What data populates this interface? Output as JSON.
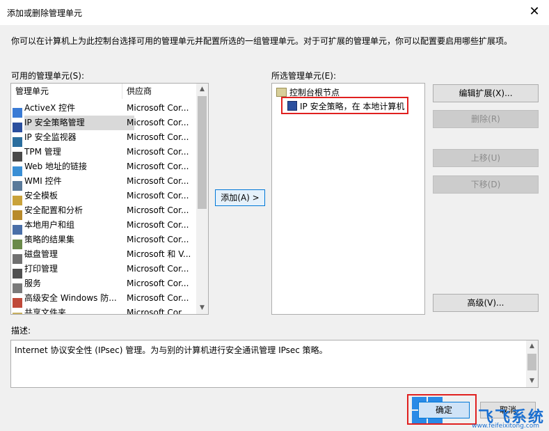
{
  "window": {
    "title": "添加或删除管理单元",
    "close_glyph": "✕"
  },
  "intro": "你可以在计算机上为此控制台选择可用的管理单元并配置所选的一组管理单元。对于可扩展的管理单元，你可以配置要启用哪些扩展项。",
  "available": {
    "label": "可用的管理单元(S):",
    "col_name": "管理单元",
    "col_vendor": "供应商",
    "items": [
      {
        "name": "ActiveX 控件",
        "vendor": "Microsoft Cor...",
        "icon": "activex-icon"
      },
      {
        "name": "IP 安全策略管理",
        "vendor": "Microsoft Cor...",
        "icon": "ip-security-policy-icon"
      },
      {
        "name": "IP 安全监视器",
        "vendor": "Microsoft Cor...",
        "icon": "ip-security-monitor-icon"
      },
      {
        "name": "TPM 管理",
        "vendor": "Microsoft Cor...",
        "icon": "tpm-icon"
      },
      {
        "name": "Web 地址的链接",
        "vendor": "Microsoft Cor...",
        "icon": "web-link-icon"
      },
      {
        "name": "WMI 控件",
        "vendor": "Microsoft Cor...",
        "icon": "wmi-icon"
      },
      {
        "name": "安全模板",
        "vendor": "Microsoft Cor...",
        "icon": "security-template-icon"
      },
      {
        "name": "安全配置和分析",
        "vendor": "Microsoft Cor...",
        "icon": "security-config-icon"
      },
      {
        "name": "本地用户和组",
        "vendor": "Microsoft Cor...",
        "icon": "users-groups-icon"
      },
      {
        "name": "策略的结果集",
        "vendor": "Microsoft Cor...",
        "icon": "rsop-icon"
      },
      {
        "name": "磁盘管理",
        "vendor": "Microsoft 和 V...",
        "icon": "disk-management-icon"
      },
      {
        "name": "打印管理",
        "vendor": "Microsoft Cor...",
        "icon": "print-management-icon"
      },
      {
        "name": "服务",
        "vendor": "Microsoft Cor...",
        "icon": "services-icon"
      },
      {
        "name": "高级安全 Windows 防...",
        "vendor": "Microsoft Cor...",
        "icon": "firewall-icon"
      },
      {
        "name": "共享文件夹",
        "vendor": "Microsoft Cor...",
        "icon": "shared-folder-icon"
      }
    ]
  },
  "add_button": "添加(A) >",
  "selected": {
    "label": "所选管理单元(E):",
    "root": "控制台根节点",
    "child": "IP 安全策略，在 本地计算机"
  },
  "buttons": {
    "edit_ext": "编辑扩展(X)...",
    "remove": "删除(R)",
    "move_up": "上移(U)",
    "move_down": "下移(D)",
    "advanced": "高级(V)..."
  },
  "description": {
    "label": "描述:",
    "text": "Internet 协议安全性 (IPsec) 管理。为与别的计算机进行安全通讯管理 IPsec 策略。"
  },
  "footer": {
    "ok": "确定",
    "cancel": "取消"
  },
  "watermark": {
    "brand": "飞飞系统",
    "url": "www.feifeixitong.com"
  },
  "colors": {
    "accent": "#0078d7",
    "highlight_box": "#e0201f"
  }
}
